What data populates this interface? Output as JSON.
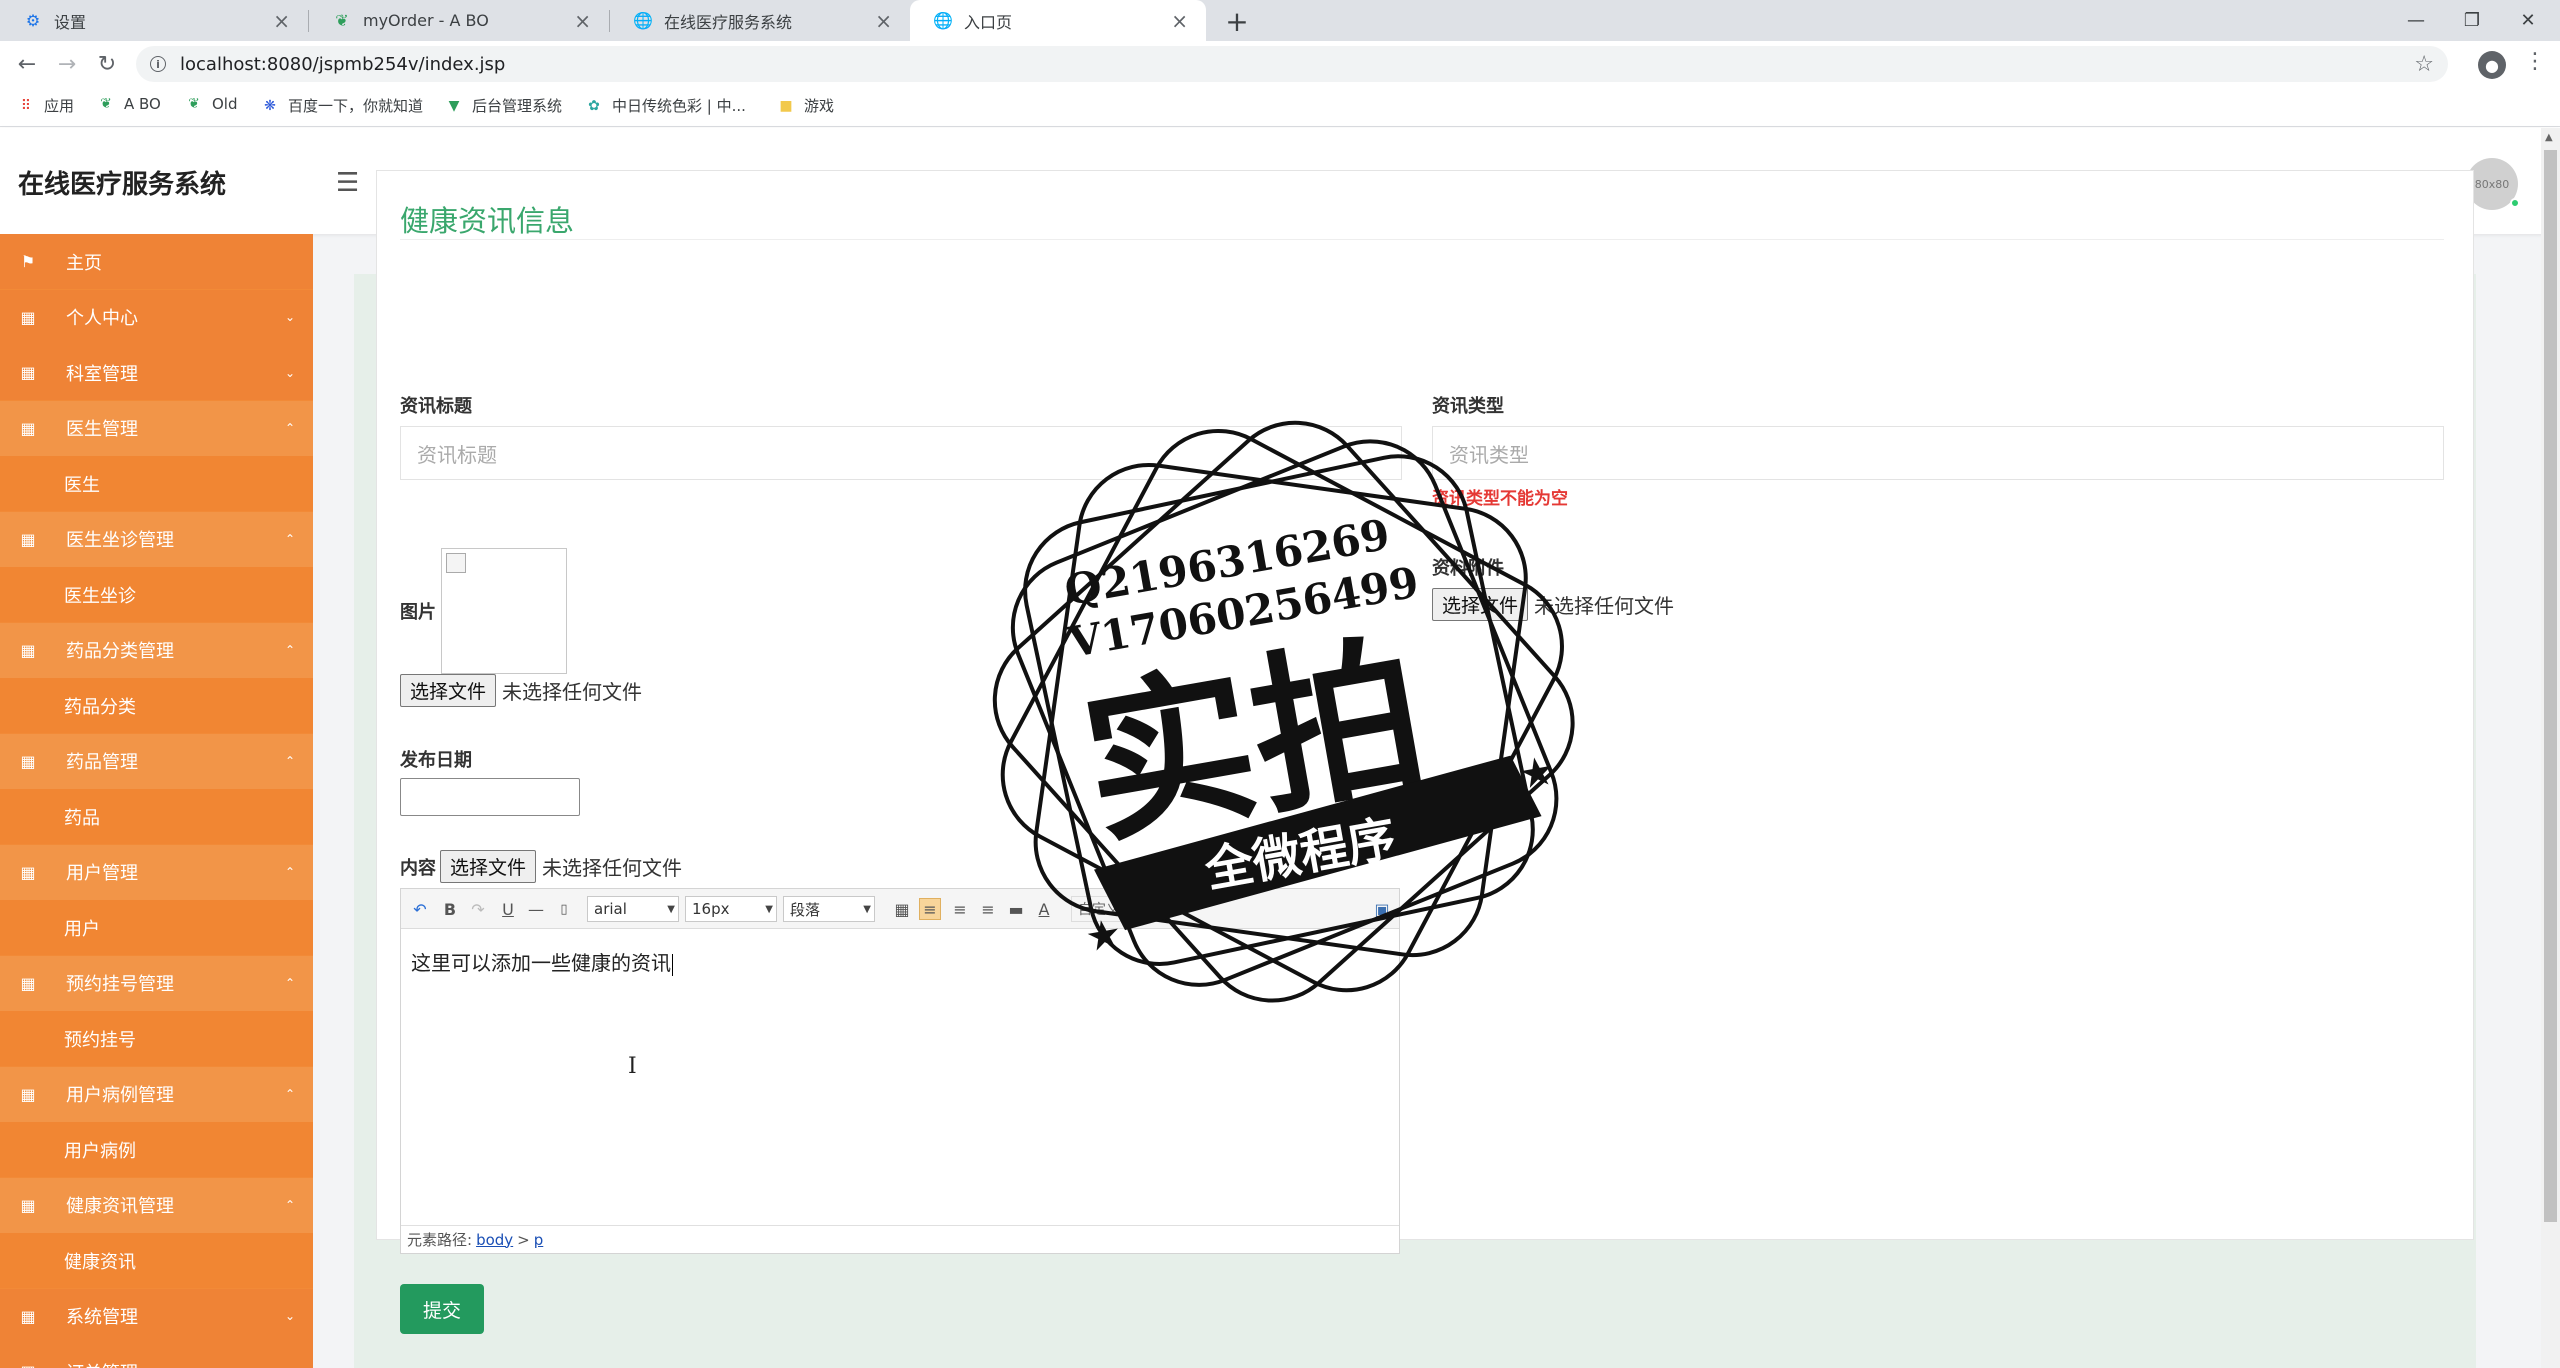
{
  "browser": {
    "tabs": [
      {
        "label": "设置",
        "icon": "gear-icon"
      },
      {
        "label": "myOrder - A BO",
        "icon": "leaf-icon"
      },
      {
        "label": "在线医疗服务系统",
        "icon": "globe-icon"
      },
      {
        "label": "入口页",
        "icon": "globe-icon"
      }
    ],
    "url": "localhost:8080/jspmb254v/index.jsp",
    "bookmarks": [
      "应用",
      "A BO",
      "Old",
      "百度一下，你就知道",
      "后台管理系统",
      "中日传统色彩 | 中...",
      "游戏"
    ]
  },
  "header": {
    "title": "在线医疗服务系统",
    "avatar_text": "80x80"
  },
  "sidebar": {
    "items": [
      {
        "label": "主页",
        "type": "parent",
        "icon": "flag-icon"
      },
      {
        "label": "个人中心",
        "type": "parent",
        "icon": "grid-icon",
        "open": false
      },
      {
        "label": "科室管理",
        "type": "parent",
        "icon": "grid-icon",
        "open": false
      },
      {
        "label": "医生管理",
        "type": "parent",
        "icon": "grid-icon",
        "open": true
      },
      {
        "label": "医生",
        "type": "child"
      },
      {
        "label": "医生坐诊管理",
        "type": "parent",
        "icon": "grid-icon",
        "open": true
      },
      {
        "label": "医生坐诊",
        "type": "child"
      },
      {
        "label": "药品分类管理",
        "type": "parent",
        "icon": "grid-icon",
        "open": true
      },
      {
        "label": "药品分类",
        "type": "child"
      },
      {
        "label": "药品管理",
        "type": "parent",
        "icon": "grid-icon",
        "open": true
      },
      {
        "label": "药品",
        "type": "child"
      },
      {
        "label": "用户管理",
        "type": "parent",
        "icon": "grid-icon",
        "open": true
      },
      {
        "label": "用户",
        "type": "child"
      },
      {
        "label": "预约挂号管理",
        "type": "parent",
        "icon": "grid-icon",
        "open": true
      },
      {
        "label": "预约挂号",
        "type": "child"
      },
      {
        "label": "用户病例管理",
        "type": "parent",
        "icon": "grid-icon",
        "open": true
      },
      {
        "label": "用户病例",
        "type": "child"
      },
      {
        "label": "健康资讯管理",
        "type": "parent",
        "icon": "grid-icon",
        "open": true
      },
      {
        "label": "健康资讯",
        "type": "child"
      },
      {
        "label": "系统管理",
        "type": "parent",
        "icon": "grid-icon",
        "open": false
      },
      {
        "label": "订单管理",
        "type": "parent",
        "icon": "grid-icon",
        "open": false
      }
    ]
  },
  "form": {
    "title": "健康资讯信息",
    "title_field": {
      "label": "资讯标题",
      "placeholder": "资讯标题",
      "value": ""
    },
    "type_field": {
      "label": "资讯类型",
      "placeholder": "资讯类型",
      "value": "",
      "error": "资讯类型不能为空"
    },
    "image_field": {
      "label": "图片",
      "button": "选择文件",
      "status": "未选择任何文件"
    },
    "attachment_field": {
      "label": "资料附件",
      "button": "选择文件",
      "status": "未选择任何文件"
    },
    "date_field": {
      "label": "发布日期",
      "value": ""
    },
    "content_field": {
      "label": "内容",
      "button": "选择文件",
      "status": "未选择任何文件"
    },
    "submit_label": "提交"
  },
  "editor": {
    "font_family": "arial",
    "font_size": "16px",
    "paragraph": "段落",
    "custom": "自定义",
    "body_text": "这里可以添加一些健康的资讯",
    "status_label": "元素路径:",
    "path": [
      "body",
      "p"
    ],
    "path_sep": ">"
  },
  "watermark": {
    "line1": "Q2196316269",
    "line2": "V17060256499",
    "main": "实拍",
    "banner": "全微程序"
  },
  "colors": {
    "sidebar": "#f28a37",
    "accent_green": "#3aa76d",
    "submit": "#239a5e",
    "error": "#e53935"
  }
}
